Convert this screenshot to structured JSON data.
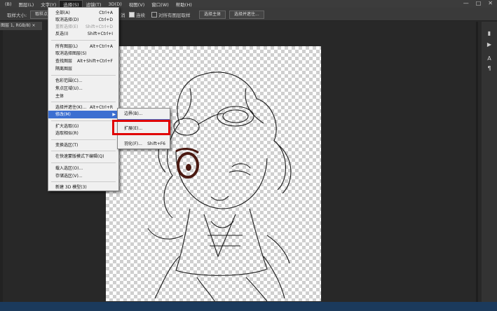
{
  "menubar": {
    "items": [
      "(B)",
      "图层(L)",
      "文字(Y)",
      "选择(S)",
      "滤镜(T)",
      "3D(D)",
      "视图(V)",
      "窗口(W)",
      "帮助(H)"
    ],
    "active_index": 3,
    "window_controls": [
      "—",
      "□",
      "✕"
    ]
  },
  "options": {
    "sample_label": "取样大小:",
    "sample_value": "取样点",
    "continuous_label": "连续",
    "all_layers_label": "对所有图层取样",
    "select_subject": "选择主体",
    "select_and_mask": "选择并遮住..."
  },
  "document": {
    "tab_label": "图层 1, RGB/8) ×"
  },
  "select_menu": {
    "items": [
      {
        "label": "全部(A)",
        "shortcut": "Ctrl+A",
        "disabled": false
      },
      {
        "label": "取消选择(D)",
        "shortcut": "Ctrl+D",
        "disabled": false
      },
      {
        "label": "重新选择(E)",
        "shortcut": "Shift+Ctrl+D",
        "disabled": true
      },
      {
        "label": "反选(I)",
        "shortcut": "Shift+Ctrl+I",
        "disabled": false
      },
      {
        "label": "所有图层(L)",
        "shortcut": "Alt+Ctrl+A",
        "disabled": false
      },
      {
        "label": "取消选择图层(S)",
        "shortcut": "",
        "disabled": false
      },
      {
        "label": "查找图层",
        "shortcut": "Alt+Shift+Ctrl+F",
        "disabled": false
      },
      {
        "label": "隔离图层",
        "shortcut": "",
        "disabled": false
      },
      {
        "label": "色彩范围(C)...",
        "shortcut": "",
        "disabled": false
      },
      {
        "label": "焦点区域(U)...",
        "shortcut": "",
        "disabled": false
      },
      {
        "label": "主体",
        "shortcut": "",
        "disabled": false
      },
      {
        "label": "选择并遮住(K)...",
        "shortcut": "Alt+Ctrl+R",
        "disabled": false
      },
      {
        "label": "修改(M)",
        "shortcut": "",
        "disabled": false,
        "highlighted": true,
        "submenu": true
      },
      {
        "label": "扩大选取(G)",
        "shortcut": "",
        "disabled": false
      },
      {
        "label": "选取相似(R)",
        "shortcut": "",
        "disabled": false
      },
      {
        "label": "变换选区(T)",
        "shortcut": "",
        "disabled": false
      },
      {
        "label": "在快速蒙版模式下编辑(Q)",
        "shortcut": "",
        "disabled": false
      },
      {
        "label": "载入选区(O)...",
        "shortcut": "",
        "disabled": false
      },
      {
        "label": "存储选区(V)...",
        "shortcut": "",
        "disabled": false
      },
      {
        "label": "新建 3D 模型(3)",
        "shortcut": "",
        "disabled": false
      }
    ]
  },
  "modify_submenu": {
    "items": [
      {
        "label": "边界(B)...",
        "shortcut": ""
      },
      {
        "label": "扩展(E)...",
        "shortcut": ""
      },
      {
        "label": "羽化(F)...",
        "shortcut": "Shift+F6"
      }
    ]
  },
  "colors": {
    "highlight": "#3c6fd1",
    "annotation": "#e00000"
  }
}
